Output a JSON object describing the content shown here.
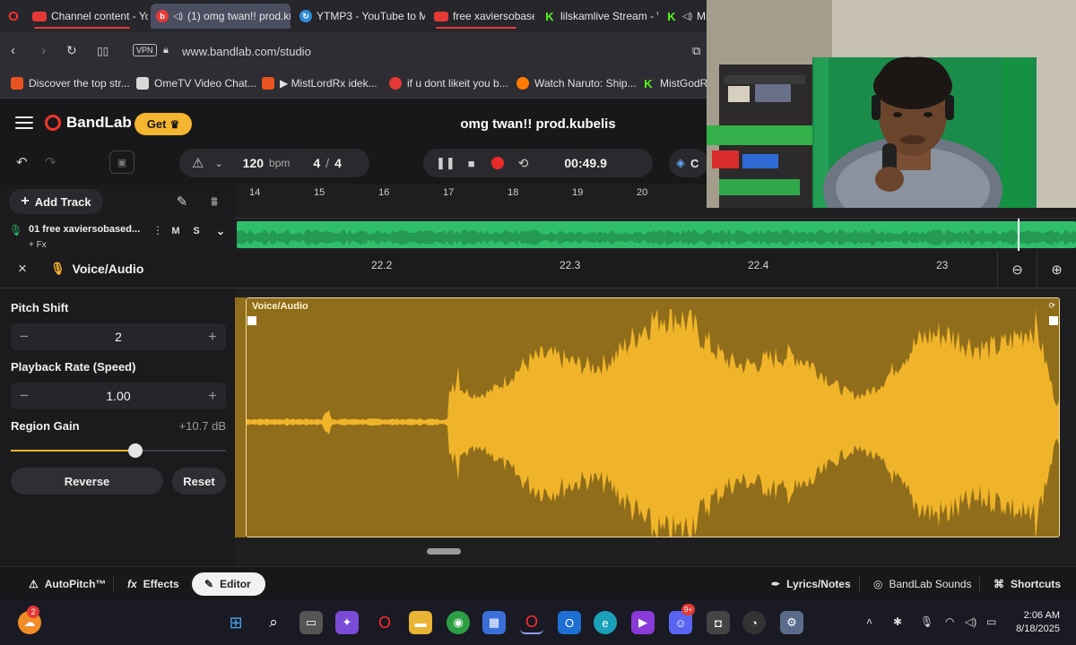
{
  "browser": {
    "tabs": [
      {
        "label": "Channel content - You",
        "icon": "youtube-icon"
      },
      {
        "label": "(1) omg twan!! prod.ku",
        "icon": "bandlab-icon"
      },
      {
        "label": "YTMP3 - YouTube to M",
        "icon": "ytmp3-icon"
      },
      {
        "label": "free xaviersobased #S",
        "icon": "youtube-icon"
      },
      {
        "label": "lilskamlive Stream - V",
        "icon": "kick-icon"
      },
      {
        "label": "Mi",
        "icon": "kick-icon"
      }
    ],
    "vpn_label": "VPN",
    "url": "www.bandlab.com/studio",
    "bookmarks": [
      {
        "label": "Discover the top str...",
        "color": "#e8531f"
      },
      {
        "label": "OmeTV Video Chat...",
        "color": "#d8d8d8"
      },
      {
        "label": "▶ MistLordRx idek...",
        "color": "#e8531f"
      },
      {
        "label": "if u dont likeit you b...",
        "color": "#e53935"
      },
      {
        "label": "Watch Naruto: Ship...",
        "color": "#ff7a00"
      },
      {
        "label": "MistGodRx",
        "color": "#53fc18"
      }
    ]
  },
  "app": {
    "logo": "BandLab",
    "get_label": "Get",
    "project_title": "omg twan!! prod.kubelis"
  },
  "transport": {
    "bpm_value": "120",
    "bpm_unit": "bpm",
    "time_sig_num": "4",
    "time_sig_sep": "/",
    "time_sig_den": "4",
    "time": "00:49.9",
    "collab_label": "C"
  },
  "tracks": {
    "add_track_label": "Add Track",
    "ruler": [
      "14",
      "15",
      "16",
      "17",
      "18",
      "19",
      "20"
    ],
    "track": {
      "name": "01  free xaviersobased...",
      "fx": "+ Fx",
      "mute": "M",
      "solo": "S"
    }
  },
  "editor": {
    "title": "Voice/Audio",
    "zoom_ticks": [
      "22.2",
      "22.3",
      "22.4",
      "23"
    ],
    "pitch_label": "Pitch Shift",
    "pitch_value": "2",
    "rate_label": "Playback Rate (Speed)",
    "rate_value": "1.00",
    "gain_label": "Region Gain",
    "gain_value": "+10.7 dB",
    "gain_fraction": 0.58,
    "reverse_label": "Reverse",
    "reset_label": "Reset",
    "region_label": "Voice/Audio"
  },
  "bottom": {
    "autopitch": "AutoPitch™",
    "effects": "Effects",
    "editor": "Editor",
    "lyrics": "Lyrics/Notes",
    "sounds": "BandLab Sounds",
    "shortcuts": "Shortcuts"
  },
  "taskbar": {
    "time": "2:06 AM",
    "date": "8/18/2025",
    "badge_left": "2",
    "badge_discord": "9+"
  },
  "colors": {
    "accent": "#f5b531",
    "region": "#8f6d1a",
    "wave": "#f0b42a",
    "track_clip": "#2fbf6a",
    "record": "#e82a2a"
  }
}
